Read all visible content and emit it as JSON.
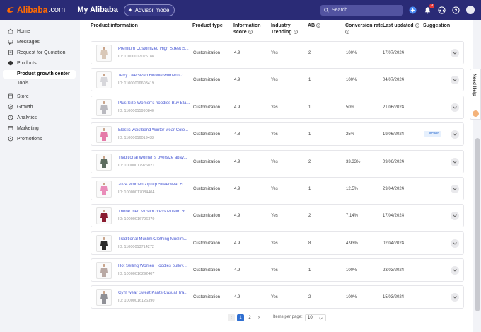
{
  "topbar": {
    "brand": "Alibaba",
    "brand_suffix": ".com",
    "title": "My Alibaba",
    "advisor_label": "Advisor mode",
    "search_placeholder": "Search",
    "notification_count": "9"
  },
  "sidebar": {
    "items": [
      {
        "label": "Home",
        "icon": "home-icon"
      },
      {
        "label": "Messages",
        "icon": "messages-icon"
      },
      {
        "label": "Request for Quotation",
        "icon": "rfq-icon"
      },
      {
        "label": "Products",
        "icon": "products-icon"
      },
      {
        "label": "Store",
        "icon": "store-icon"
      },
      {
        "label": "Growth",
        "icon": "growth-icon"
      },
      {
        "label": "Analytics",
        "icon": "analytics-icon"
      },
      {
        "label": "Marketing",
        "icon": "marketing-icon"
      },
      {
        "label": "Promotions",
        "icon": "promotions-icon"
      }
    ],
    "subitems": [
      {
        "label": "Product growth center"
      },
      {
        "label": "Tools"
      }
    ]
  },
  "table": {
    "headers": {
      "product": "Product information",
      "type": "Product type",
      "score_line1": "Information",
      "score_line2": "score",
      "trending_line1": "Industry",
      "trending_line2": "Trending",
      "ab": "AB",
      "conversion": "Conversion rate",
      "updated": "Last updated",
      "suggestion": "Suggestion"
    },
    "rows": [
      {
        "name": "Premium Customized High Street S...",
        "id": "ID: 11000017025188",
        "type": "Customization",
        "score": "4.9",
        "trending": "Yes",
        "ab": "2",
        "conversion": "100%",
        "updated": "17/07/2024",
        "suggestion": ""
      },
      {
        "name": "Terry Oversized Hoodie women Cr...",
        "id": "ID: 11000016603419",
        "type": "Customization",
        "score": "4.9",
        "trending": "Yes",
        "ab": "1",
        "conversion": "100%",
        "updated": "04/07/2024",
        "suggestion": ""
      },
      {
        "name": "Plus Size Women's hoodies Buy Bla...",
        "id": "ID: 11000015990840",
        "type": "Customization",
        "score": "4.9",
        "trending": "Yes",
        "ab": "1",
        "conversion": "50%",
        "updated": "21/06/2024",
        "suggestion": ""
      },
      {
        "name": "Elastic waistband Winter wear Colo...",
        "id": "ID: 11000016019433",
        "type": "Customization",
        "score": "4.8",
        "trending": "Yes",
        "ab": "1",
        "conversion": "25%",
        "updated": "19/06/2024",
        "suggestion": "1 action"
      },
      {
        "name": "Traditional Women's oversize abay...",
        "id": "ID: 10000017976021",
        "type": "Customization",
        "score": "4.9",
        "trending": "Yes",
        "ab": "2",
        "conversion": "33.33%",
        "updated": "09/06/2024",
        "suggestion": ""
      },
      {
        "name": "2024 Women Zip Up Streetwear H...",
        "id": "ID: 10000017084404",
        "type": "Customization",
        "score": "4.9",
        "trending": "Yes",
        "ab": "1",
        "conversion": "12.5%",
        "updated": "29/04/2024",
        "suggestion": ""
      },
      {
        "name": "Thobe men Muslim dress Muslim R...",
        "id": "ID: 10000016796379",
        "type": "Customization",
        "score": "4.9",
        "trending": "Yes",
        "ab": "2",
        "conversion": "7.14%",
        "updated": "17/04/2024",
        "suggestion": ""
      },
      {
        "name": "Traditional Muslim Clothing Muslim...",
        "id": "ID: 11000013714272",
        "type": "Customization",
        "score": "4.9",
        "trending": "Yes",
        "ab": "8",
        "conversion": "4.93%",
        "updated": "02/04/2024",
        "suggestion": ""
      },
      {
        "name": "Hot Selling Women Hoodies pullov...",
        "id": "ID: 10000016292407",
        "type": "Customization",
        "score": "4.9",
        "trending": "Yes",
        "ab": "1",
        "conversion": "100%",
        "updated": "23/03/2024",
        "suggestion": ""
      },
      {
        "name": "Gym wear Sweat Pants Casual Tra...",
        "id": "ID: 10000016126390",
        "type": "Customization",
        "score": "4.9",
        "trending": "Yes",
        "ab": "2",
        "conversion": "100%",
        "updated": "15/03/2024",
        "suggestion": ""
      }
    ]
  },
  "pagination": {
    "prev": "‹",
    "pages": [
      "1",
      "2"
    ],
    "next": "›",
    "items_per_page_label": "Items per page:",
    "items_per_page_value": "10"
  },
  "help": {
    "label": "Need Help"
  },
  "colors": {
    "topbar": "#2a2b76",
    "brand_orange": "#ff6a00",
    "link_blue": "#4b5bd4",
    "accent_blue": "#2f6fd1"
  },
  "thumb_colors": [
    "#d9c8b8",
    "#d7d7db",
    "#b9b9bf",
    "#e57aa8",
    "#5b6b5e",
    "#e98cb9",
    "#8a1c30",
    "#2a2a2a",
    "#b9a9a4",
    "#8f9096"
  ]
}
